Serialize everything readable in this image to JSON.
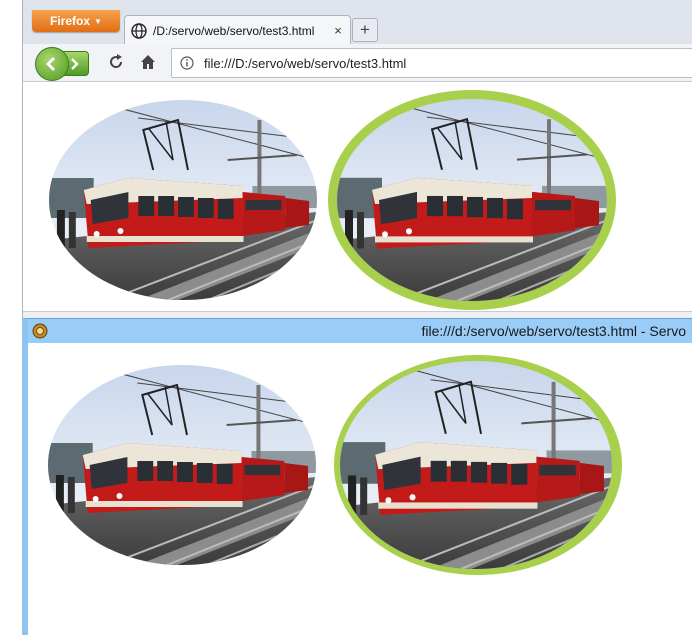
{
  "firefox": {
    "app_button": "Firefox",
    "tab_title": "/D:/servo/web/servo/test3.html",
    "tab_close": "×",
    "new_tab": "+",
    "url": "file:///D:/servo/web/servo/test3.html"
  },
  "servo": {
    "window_title": "file:///d:/servo/web/servo/test3.html - Servo"
  },
  "images": {
    "subject": "red-tram",
    "border_color": "#a8d04c"
  },
  "icons": {
    "back": "back-arrow-icon",
    "forward": "forward-arrow-icon",
    "reload": "reload-icon",
    "home": "home-icon",
    "info": "info-icon",
    "globe": "globe-icon",
    "servo_logo": "servo-logo-icon"
  }
}
